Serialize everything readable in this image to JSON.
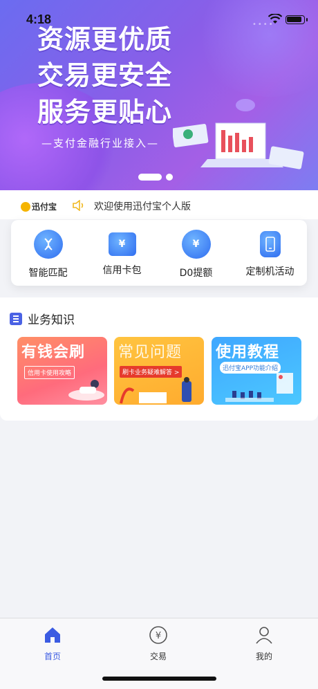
{
  "status": {
    "time": "4:18"
  },
  "banner": {
    "lines": [
      "资源更优质",
      "交易更安全",
      "服务更贴心"
    ],
    "subline": "—支付金融行业接入—",
    "page_index": 1,
    "page_count": 2
  },
  "notice": {
    "brand": "迅付宝",
    "text": "欢迎使用迅付宝个人版"
  },
  "features": [
    {
      "label": "智能匹配",
      "icon": "dna-icon"
    },
    {
      "label": "信用卡包",
      "icon": "card-wallet-icon",
      "glyph": "¥"
    },
    {
      "label": "D0提额",
      "icon": "yen-coin-icon",
      "glyph": "¥"
    },
    {
      "label": "定制机活动",
      "icon": "phone-icon"
    }
  ],
  "knowledge": {
    "title": "业务知识",
    "cards": [
      {
        "title": "有钱会刷",
        "tag": "信用卡使用攻略"
      },
      {
        "title": "常见问题",
        "tag": "刷卡业务疑难解答 >"
      },
      {
        "title": "使用教程",
        "tag": "迅付宝APP功能介绍"
      }
    ]
  },
  "tabs": [
    {
      "label": "首页",
      "icon": "home-icon",
      "active": true
    },
    {
      "label": "交易",
      "icon": "yen-circle-icon",
      "active": false
    },
    {
      "label": "我的",
      "icon": "user-icon",
      "active": false
    }
  ],
  "colors": {
    "accent": "#3b5be2",
    "banner": "#8a5ee8"
  }
}
